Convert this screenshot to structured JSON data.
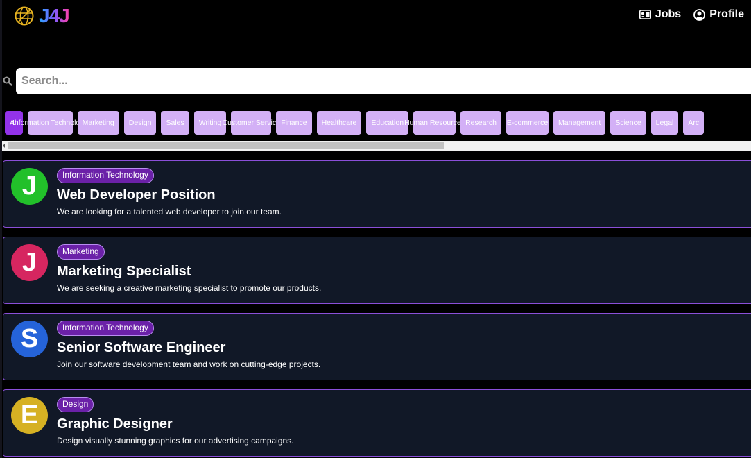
{
  "header": {
    "logo_text": "J4J",
    "nav": [
      {
        "label": "Jobs",
        "icon": "id-card-icon"
      },
      {
        "label": "Profile",
        "icon": "user-circle-icon"
      }
    ]
  },
  "search": {
    "placeholder": "Search...",
    "value": ""
  },
  "categories": {
    "selected": "All",
    "items": [
      "All",
      "Information Technology",
      "Marketing",
      "Design",
      "Sales",
      "Writing",
      "Customer Service",
      "Finance",
      "Healthcare",
      "Education",
      "Human Resources",
      "Research",
      "E-commerce",
      "Management",
      "Science",
      "Legal",
      "Arc"
    ]
  },
  "jobs": [
    {
      "initial": "J",
      "avatar_color": "#22c02a",
      "category": "Information Technology",
      "title": "Web Developer Position",
      "description": "We are looking for a talented web developer to join our team."
    },
    {
      "initial": "J",
      "avatar_color": "#d62660",
      "category": "Marketing",
      "title": "Marketing Specialist",
      "description": "We are seeking a creative marketing specialist to promote our products."
    },
    {
      "initial": "S",
      "avatar_color": "#2563d9",
      "category": "Information Technology",
      "title": "Senior Software Engineer",
      "description": "Join our software development team and work on cutting-edge projects."
    },
    {
      "initial": "E",
      "avatar_color": "#d6b123",
      "category": "Design",
      "title": "Graphic Designer",
      "description": "Design visually stunning graphics for our advertising campaigns."
    }
  ],
  "colors": {
    "accent": "#9333ea",
    "chip": "#d3b0f6",
    "card_background": "#111827",
    "card_border": "#8b4fd8"
  }
}
